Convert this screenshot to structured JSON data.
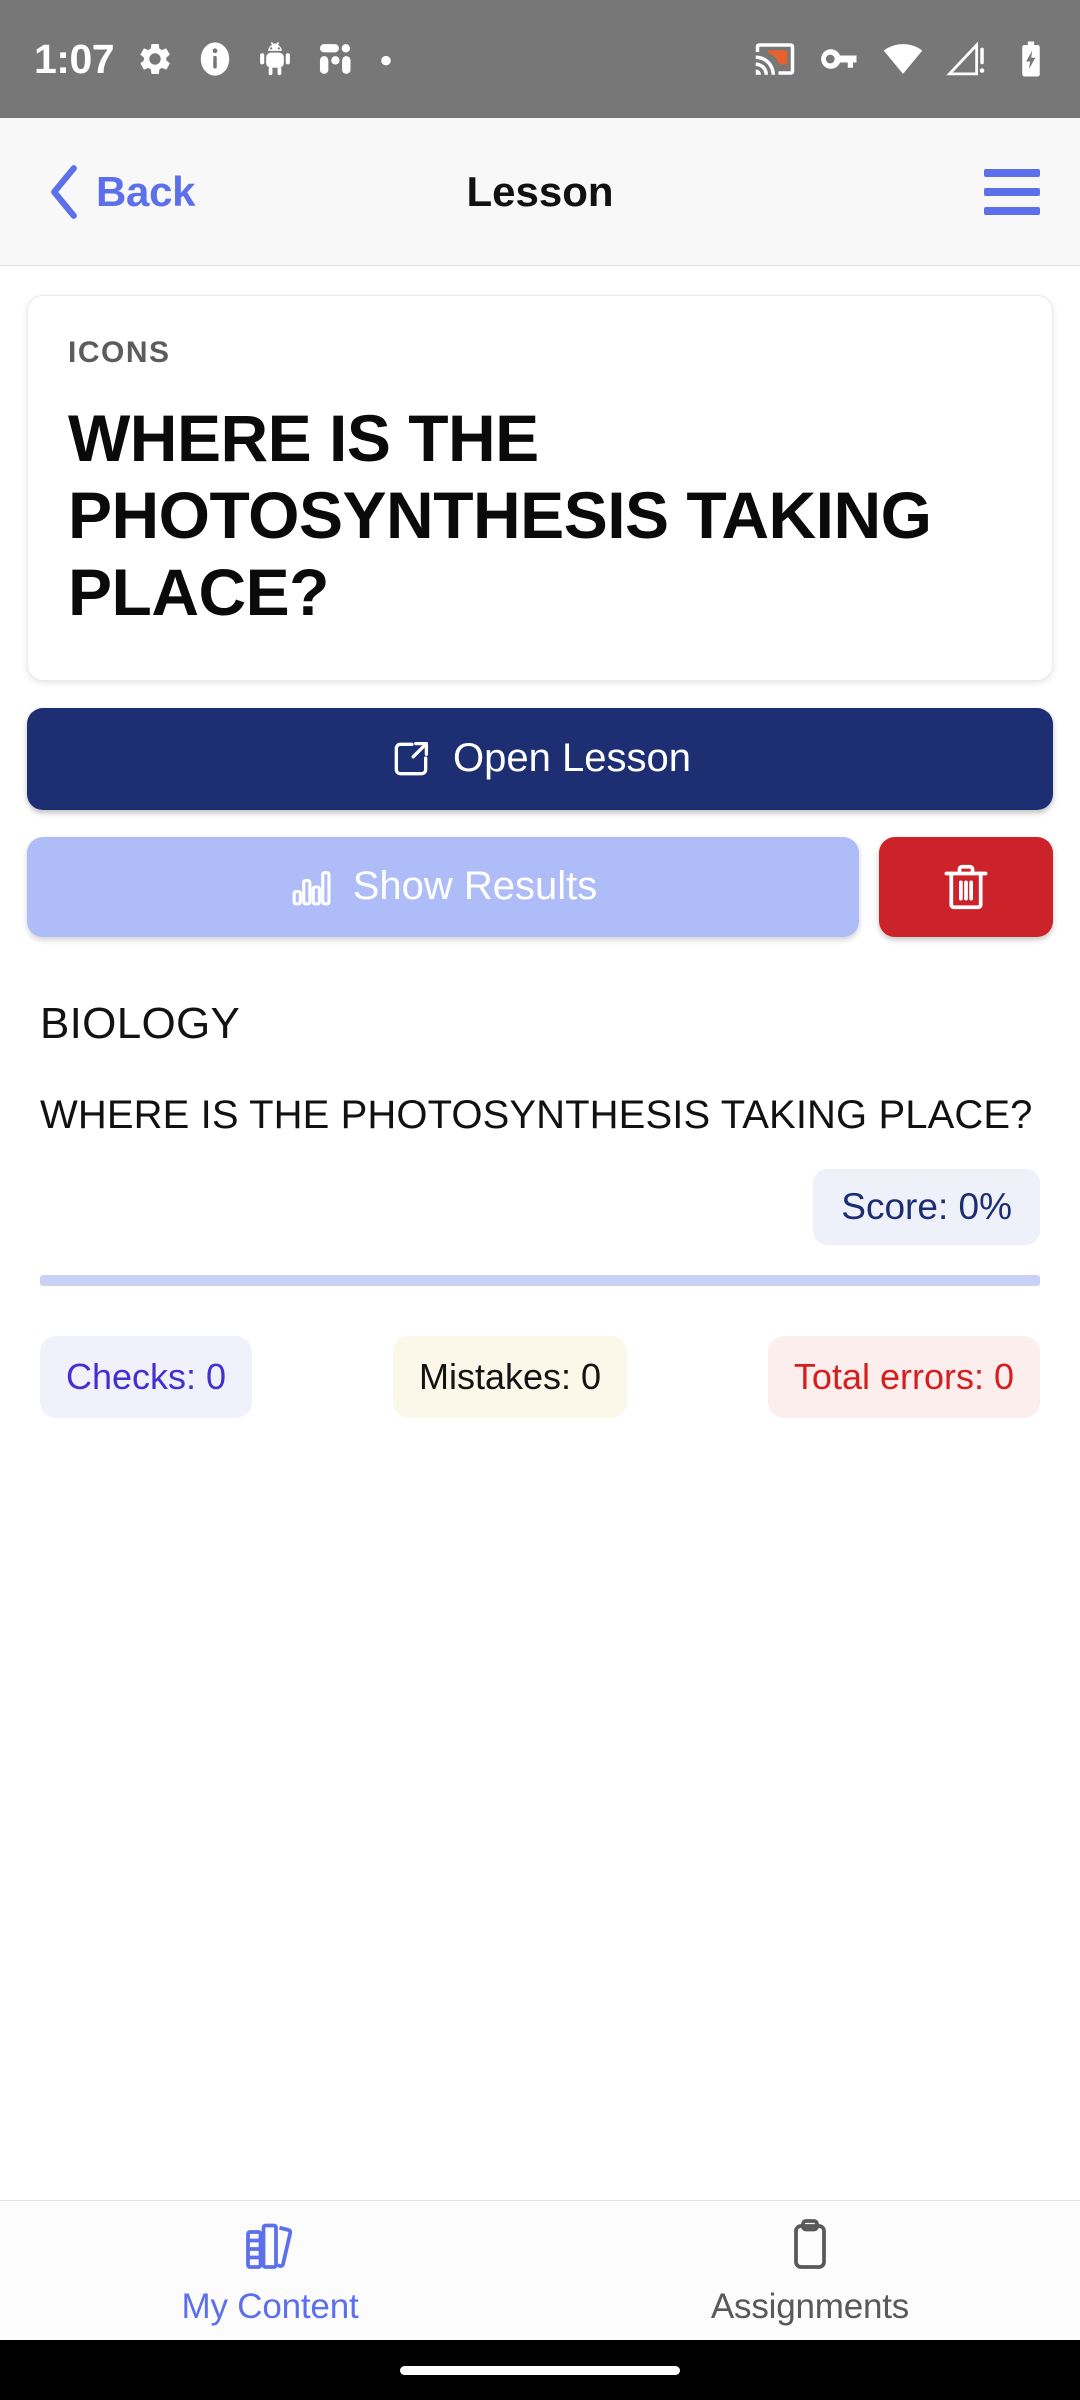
{
  "status_bar": {
    "time": "1:07",
    "left_icons": [
      "gear-icon",
      "info-icon",
      "android-bug-icon",
      "debug-tool-icon",
      "dot-icon"
    ],
    "right_icons": [
      "cast-icon",
      "vpn-key-icon",
      "wifi-icon",
      "cellular-warning-icon",
      "battery-charging-icon"
    ],
    "background": "#777777",
    "cast_accent": "#E8602C"
  },
  "header": {
    "back_label": "Back",
    "title": "Lesson",
    "menu_icon": "hamburger-menu-icon",
    "accent": "#5B70EA"
  },
  "lesson_card": {
    "eyebrow": "ICONS",
    "title": "WHERE IS THE PHOTOSYNTHESIS TAKING PLACE?"
  },
  "actions": {
    "open_lesson": {
      "label": "Open Lesson",
      "icon": "external-link-icon",
      "color": "#1E2E73"
    },
    "show_results": {
      "label": "Show Results",
      "icon": "bar-chart-icon",
      "color": "#AEBCF7"
    },
    "delete": {
      "icon": "trash-icon",
      "color": "#CC2229"
    }
  },
  "results": {
    "subject": "BIOLOGY",
    "question": "WHERE IS THE PHOTOSYNTHESIS TAKING PLACE?",
    "score_label": "Score: 0%",
    "progress_percent": 0,
    "chips": [
      {
        "label": "Checks: 0",
        "text_color": "#4530CF",
        "bg_color": "#F1F1FC"
      },
      {
        "label": "Mistakes: 0",
        "text_color": "#131313",
        "bg_color": "#FBF8EA"
      },
      {
        "label": "Total errors: 0",
        "text_color": "#D51F1F",
        "bg_color": "#FDEEEE"
      }
    ]
  },
  "bottom_nav": {
    "items": [
      {
        "label": "My Content",
        "icon": "books-icon",
        "active": true
      },
      {
        "label": "Assignments",
        "icon": "clipboard-icon",
        "active": false
      }
    ],
    "active_color": "#5B70EA",
    "inactive_color": "#595959"
  }
}
